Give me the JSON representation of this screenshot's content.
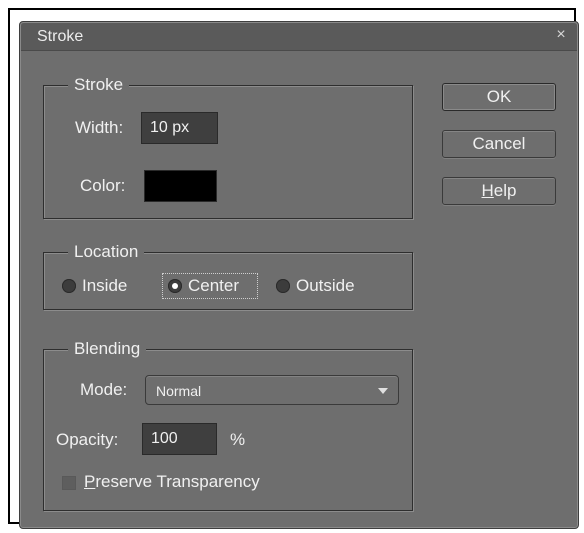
{
  "dialog": {
    "title": "Stroke",
    "close_symbol": "×"
  },
  "stroke_group": {
    "legend": "Stroke",
    "width_label": "Width:",
    "width_value": "10 px",
    "color_label": "Color:",
    "color_value": "#000000"
  },
  "location_group": {
    "legend": "Location",
    "options": [
      {
        "label": "Inside",
        "selected": false
      },
      {
        "label": "Center",
        "selected": true
      },
      {
        "label": "Outside",
        "selected": false
      }
    ]
  },
  "blending_group": {
    "legend": "Blending",
    "mode_label": "Mode:",
    "mode_value": "Normal",
    "opacity_label": "Opacity:",
    "opacity_value": "100",
    "opacity_unit": "%",
    "preserve_mnemonic": "P",
    "preserve_rest": "reserve Transparency",
    "preserve_checked": false
  },
  "buttons": {
    "ok": "OK",
    "cancel": "Cancel",
    "help_mnemonic": "H",
    "help_rest": "elp"
  }
}
